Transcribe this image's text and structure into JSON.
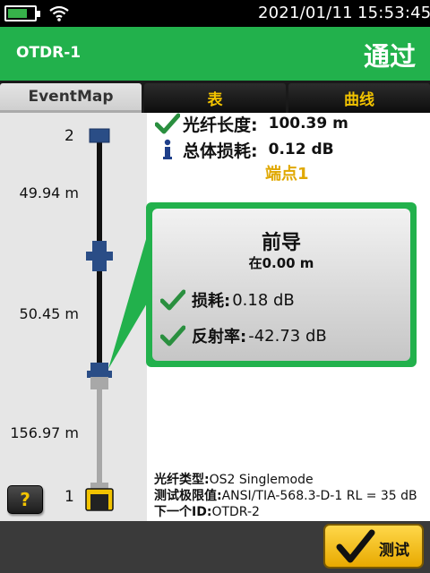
{
  "status_bar": {
    "date": "2021/01/11",
    "time": "15:53:45",
    "battery_level": 0.75,
    "icons": [
      "battery-icon",
      "wifi-icon"
    ]
  },
  "header": {
    "title": "OTDR-1",
    "result": "通过"
  },
  "tabs": [
    {
      "label": "EventMap",
      "selected": true
    },
    {
      "label": "表",
      "selected": false
    },
    {
      "label": "曲线",
      "selected": false
    }
  ],
  "event_map": {
    "segment_lengths": [
      "49.94 m",
      "50.45 m",
      "156.97 m"
    ],
    "end_labels": [
      "2",
      "1"
    ]
  },
  "summary": {
    "fiber_length_label": "光纤长度:",
    "fiber_length_value": "100.39 m",
    "total_loss_label": "总体损耗:",
    "total_loss_value": "0.12 dB",
    "endpoint": "端点1"
  },
  "event_popup": {
    "title": "前导",
    "position": "在0.00 m",
    "loss_label": "损耗:",
    "loss_value": "0.18 dB",
    "reflectance_label": "反射率:",
    "reflectance_value": "-42.73 dB"
  },
  "fiber_info": {
    "type_label": "光纤类型:",
    "type_value": "OS2 Singlemode",
    "limit_label": "测试极限值:",
    "limit_value": "ANSI/TIA-568.3-D-1 RL = 35 dB",
    "next_id_label": "下一个ID:",
    "next_id_value": "OTDR-2"
  },
  "buttons": {
    "help": "?",
    "test": "测试"
  },
  "colors": {
    "brand_green": "#22b14c",
    "accent_yellow": "#f2c300",
    "endpoint_text": "#e0a800",
    "fiber_black": "#111111",
    "fiber_gray": "#a8a8a8",
    "connector_blue": "#2a4d86"
  }
}
